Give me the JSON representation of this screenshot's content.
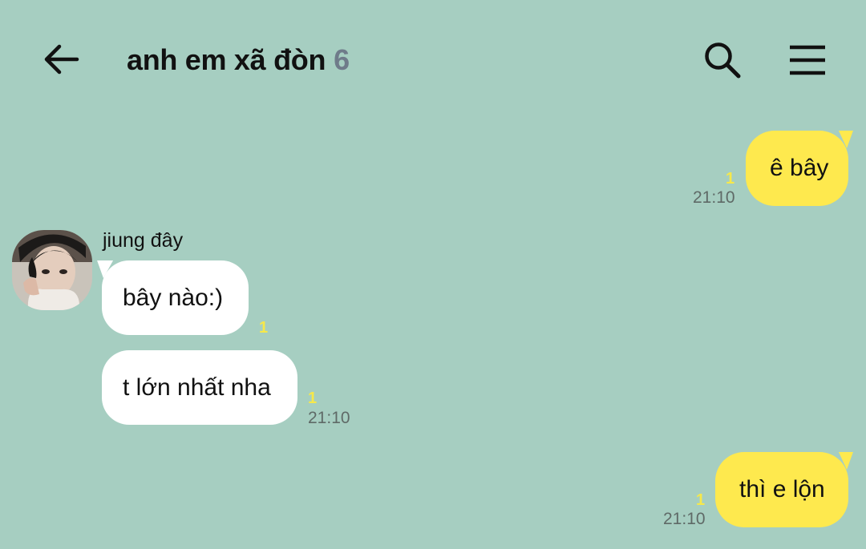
{
  "colors": {
    "background": "#a6cec1",
    "text": "#111111",
    "my_bubble": "#fee94e",
    "other_bubble": "#ffffff",
    "unread": "#f6e84a",
    "time": "#5f6a67",
    "member_count": "#6f7b8a"
  },
  "header": {
    "back_icon": "arrow-left-icon",
    "title": "anh em xã đòn",
    "member_count": "6",
    "search_icon": "search-icon",
    "menu_icon": "menu-icon"
  },
  "messages": [
    {
      "sender": "me",
      "text": "ê bây",
      "unread": "1",
      "time": "21:10"
    },
    {
      "sender": "other",
      "name": "jiung đây",
      "text": "bây nào:)",
      "unread": "1",
      "time": ""
    },
    {
      "sender": "other",
      "name": "",
      "text": "t lớn nhất nha",
      "unread": "1",
      "time": "21:10"
    },
    {
      "sender": "me",
      "text": "thì e lộn",
      "unread": "1",
      "time": "21:10"
    }
  ]
}
